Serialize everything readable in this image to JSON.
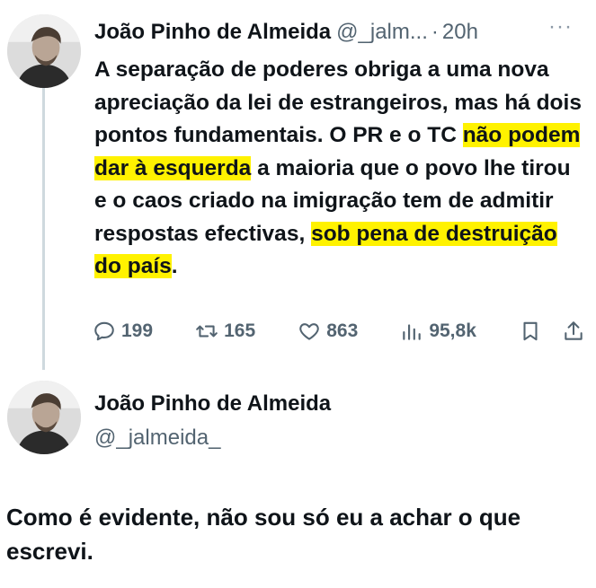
{
  "tweet1": {
    "name": "João Pinho de Almeida",
    "handle": "@_jalm...",
    "separator": "·",
    "time": "20h",
    "more": "···",
    "text_parts": [
      "A separação de poderes obriga a uma nova apreciação da lei de estrangeiros, mas há dois pontos fundamentais. O PR e o TC ",
      "não podem dar à esquerda",
      " a maioria que o povo lhe tirou e o caos criado na imigração tem de admitir respostas efectivas, ",
      "sob pena de destruição do país",
      "."
    ],
    "actions": {
      "replies": "199",
      "retweets": "165",
      "likes": "863",
      "views": "95,8k"
    },
    "icons": [
      "reply-icon",
      "retweet-icon",
      "like-icon",
      "views-icon",
      "bookmark-icon",
      "share-icon"
    ]
  },
  "tweet2": {
    "name": "João Pinho de Almeida",
    "handle": "@_jalmeida_",
    "text": "Como é evidente, não sou só eu a achar o que escrevi."
  },
  "colors": {
    "highlight": "#fff200",
    "secondary": "#536471",
    "text": "#0f1419",
    "thread_line": "#cfd9de"
  }
}
